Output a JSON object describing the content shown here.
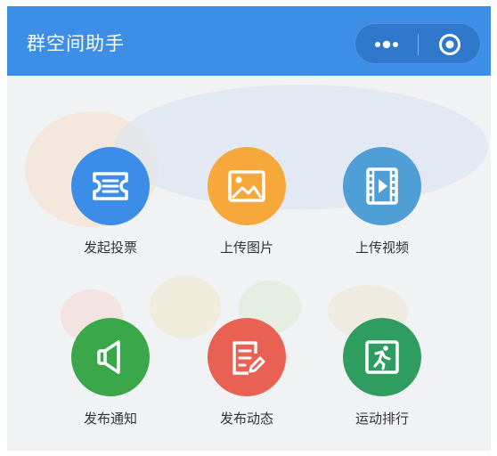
{
  "header": {
    "title": "群空间助手",
    "more_icon": "more-dots-icon",
    "close_icon": "target-close-icon"
  },
  "colors": {
    "header_bg": "#3d8ee6",
    "capsule_bg": "#2f78cc",
    "vote": "#3c8de8",
    "image": "#f6a83a",
    "video": "#4f9ed6",
    "notice": "#3aa84a",
    "post": "#e86152",
    "steps": "#2f9d5f"
  },
  "actions": [
    {
      "label": "发起投票",
      "icon": "vote-ticket-icon"
    },
    {
      "label": "上传图片",
      "icon": "image-icon"
    },
    {
      "label": "上传视频",
      "icon": "video-film-icon"
    },
    {
      "label": "发布通知",
      "icon": "speaker-icon"
    },
    {
      "label": "发布动态",
      "icon": "edit-note-icon"
    },
    {
      "label": "运动排行",
      "icon": "running-man-icon"
    }
  ]
}
